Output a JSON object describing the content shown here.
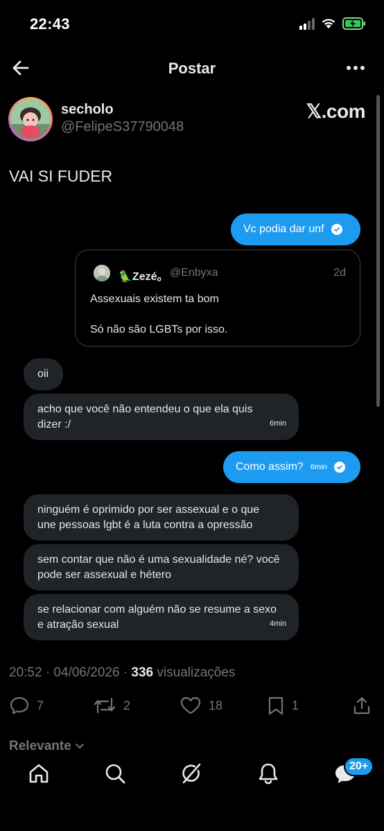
{
  "status_bar": {
    "time": "22:43"
  },
  "header": {
    "title": "Postar"
  },
  "author": {
    "display_name": "secholo",
    "handle": "@FelipeS37790048",
    "source_logo": "𝕏.com"
  },
  "post": {
    "text": "VAI SI FUDER"
  },
  "chat": {
    "msg1": {
      "text": "Vc podia dar unf"
    },
    "quote": {
      "name": "🦜Zezé。",
      "handle": "@Enbyxa",
      "date": "2d",
      "line1": "Assexuais existem ta bom",
      "line2": "Só não são LGBTs por isso."
    },
    "msg2": {
      "text": "oii"
    },
    "msg3": {
      "line1": "acho que você não entendeu o que ela quis",
      "line2": "dizer :/",
      "time": "6min"
    },
    "msg4": {
      "text": "Como assim?",
      "time": "6min"
    },
    "msg5": {
      "line1": "ninguém é oprimido por ser assexual e o que",
      "line2": "une pessoas lgbt é a luta contra a opressão"
    },
    "msg6": {
      "line1": "sem contar que não é uma sexualidade né? você",
      "line2": "pode ser assexual e hétero"
    },
    "msg7": {
      "line1": "se relacionar com alguém não se resume a sexo",
      "line2": "e atração sexual",
      "time": "4min"
    }
  },
  "meta": {
    "time_date": "20:52 · 04/06/2026 · ",
    "views": "336",
    "views_label": " visualizações"
  },
  "actions": {
    "replies": "7",
    "reposts": "2",
    "likes": "18",
    "bookmarks": "1"
  },
  "sort": {
    "label": "Relevante"
  },
  "tabbar": {
    "messages_badge": "20+"
  },
  "colors": {
    "accent": "#1d9bf0",
    "background": "#000000",
    "bubble_in": "#202327",
    "muted": "#71767b"
  }
}
